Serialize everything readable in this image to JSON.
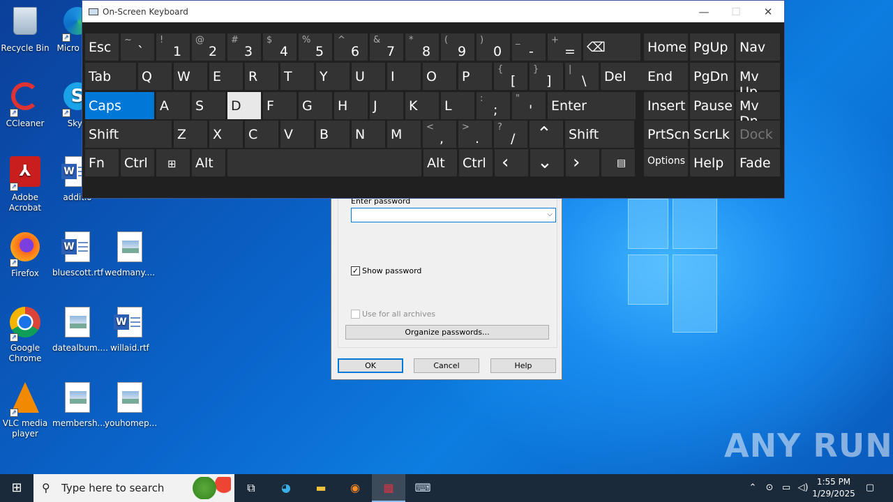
{
  "colors": {
    "accent": "#0078d7",
    "osk_bg": "#202020",
    "key_bg": "#333333",
    "taskbar": "#1b2a3a"
  },
  "desktop": {
    "icons": [
      {
        "label": "Recycle Bin",
        "icon": "recycle-bin-icon"
      },
      {
        "label": "Micro Edg",
        "icon": "edge-icon"
      },
      {
        "label": "CCleaner",
        "icon": "ccleaner-icon"
      },
      {
        "label": "Skyp",
        "icon": "skype-icon"
      },
      {
        "label": "Adobe Acrobat",
        "icon": "acrobat-icon"
      },
      {
        "label": "additio",
        "icon": "word-doc-icon"
      },
      {
        "label": "Firefox",
        "icon": "firefox-icon"
      },
      {
        "label": "bluescott.rtf",
        "icon": "word-doc-icon"
      },
      {
        "label": "wedmany....",
        "icon": "image-file-icon"
      },
      {
        "label": "Google Chrome",
        "icon": "chrome-icon"
      },
      {
        "label": "datealbum....",
        "icon": "image-file-icon"
      },
      {
        "label": "willaid.rtf",
        "icon": "word-doc-icon"
      },
      {
        "label": "VLC media player",
        "icon": "vlc-icon"
      },
      {
        "label": "membersh...",
        "icon": "image-file-icon"
      },
      {
        "label": "youhomep...",
        "icon": "image-file-icon"
      }
    ],
    "watermark": "ANY RUN"
  },
  "dialog": {
    "enter_password": "Enter password",
    "show_password": "Show password",
    "show_password_checked": true,
    "use_for_all": "Use for all archives",
    "organize": "Organize passwords...",
    "ok": "OK",
    "cancel": "Cancel",
    "help": "Help"
  },
  "osk": {
    "title": "On-Screen Keyboard",
    "controls": {
      "minimize": "—",
      "maximize": "☐",
      "close": "✕"
    },
    "rows": [
      [
        {
          "m": "Esc"
        },
        {
          "s": "~",
          "b": "`"
        },
        {
          "s": "!",
          "b": "1"
        },
        {
          "s": "@",
          "b": "2"
        },
        {
          "s": "#",
          "b": "3"
        },
        {
          "s": "$",
          "b": "4"
        },
        {
          "s": "%",
          "b": "5"
        },
        {
          "s": "^",
          "b": "6"
        },
        {
          "s": "&",
          "b": "7"
        },
        {
          "s": "*",
          "b": "8"
        },
        {
          "s": "(",
          "b": "9"
        },
        {
          "s": ")",
          "b": "0"
        },
        {
          "s": "_",
          "b": "-"
        },
        {
          "s": "+",
          "b": "="
        },
        {
          "m": "⌫"
        },
        {
          "m": "Home"
        },
        {
          "m": "PgUp"
        },
        {
          "m": "Nav"
        }
      ],
      [
        {
          "m": "Tab"
        },
        {
          "m": "Q"
        },
        {
          "m": "W"
        },
        {
          "m": "E"
        },
        {
          "m": "R"
        },
        {
          "m": "T"
        },
        {
          "m": "Y"
        },
        {
          "m": "U"
        },
        {
          "m": "I"
        },
        {
          "m": "O"
        },
        {
          "m": "P"
        },
        {
          "s": "{",
          "b": "["
        },
        {
          "s": "}",
          "b": "]"
        },
        {
          "s": "|",
          "b": "\\"
        },
        {
          "m": "Del"
        },
        {
          "m": "End"
        },
        {
          "m": "PgDn"
        },
        {
          "m": "Mv Up"
        }
      ],
      [
        {
          "m": "Caps"
        },
        {
          "m": "A"
        },
        {
          "m": "S"
        },
        {
          "m": "D"
        },
        {
          "m": "F"
        },
        {
          "m": "G"
        },
        {
          "m": "H"
        },
        {
          "m": "J"
        },
        {
          "m": "K"
        },
        {
          "m": "L"
        },
        {
          "s": ":",
          "b": ";"
        },
        {
          "s": "\"",
          "b": "'"
        },
        {
          "m": "Enter"
        },
        {
          "m": "Insert"
        },
        {
          "m": "Pause"
        },
        {
          "m": "Mv Dn"
        }
      ],
      [
        {
          "m": "Shift"
        },
        {
          "m": "Z"
        },
        {
          "m": "X"
        },
        {
          "m": "C"
        },
        {
          "m": "V"
        },
        {
          "m": "B"
        },
        {
          "m": "N"
        },
        {
          "m": "M"
        },
        {
          "s": "<",
          "b": ","
        },
        {
          "s": ">",
          "b": "."
        },
        {
          "s": "?",
          "b": "/"
        },
        {
          "m": "⌃"
        },
        {
          "m": "Shift"
        },
        {
          "m": "PrtScn"
        },
        {
          "m": "ScrLk"
        },
        {
          "m": "Dock"
        }
      ],
      [
        {
          "m": "Fn"
        },
        {
          "m": "Ctrl"
        },
        {
          "m": "⊞"
        },
        {
          "m": "Alt"
        },
        {
          "m": ""
        },
        {
          "m": "Alt"
        },
        {
          "m": "Ctrl"
        },
        {
          "m": "‹"
        },
        {
          "m": "⌄"
        },
        {
          "m": "›"
        },
        {
          "m": "▤"
        },
        {
          "m": "Options"
        },
        {
          "m": "Help"
        },
        {
          "m": "Fade"
        }
      ]
    ]
  },
  "taskbar": {
    "search_placeholder": "Type here to search",
    "time": "1:55 PM",
    "date": "1/29/2025"
  }
}
